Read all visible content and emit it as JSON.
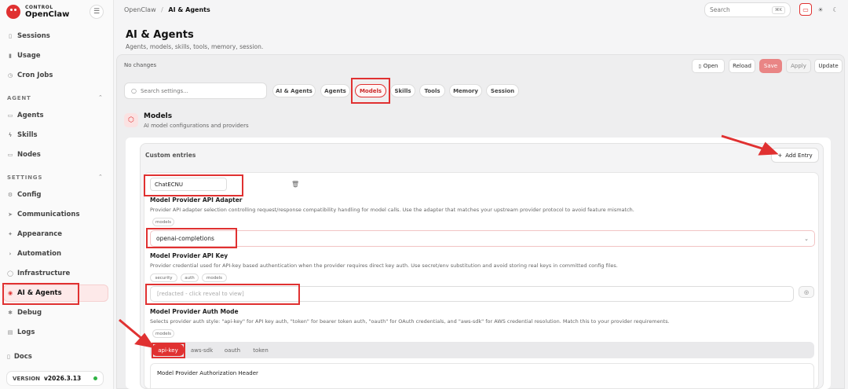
{
  "brand": {
    "label_top": "CONTROL",
    "name": "OpenClaw"
  },
  "sidebar": {
    "top_items": [
      {
        "label": "Sessions",
        "icon": "file-icon"
      },
      {
        "label": "Usage",
        "icon": "bar-chart-icon"
      },
      {
        "label": "Cron Jobs",
        "icon": "clock-icon"
      }
    ],
    "agent_section": "AGENT",
    "agent_items": [
      {
        "label": "Agents",
        "icon": "folder-icon"
      },
      {
        "label": "Skills",
        "icon": "zap-icon"
      },
      {
        "label": "Nodes",
        "icon": "monitor-icon"
      }
    ],
    "settings_section": "SETTINGS",
    "settings_items": [
      {
        "label": "Config",
        "icon": "gear-icon"
      },
      {
        "label": "Communications",
        "icon": "send-icon"
      },
      {
        "label": "Appearance",
        "icon": "sparkle-icon"
      },
      {
        "label": "Automation",
        "icon": "terminal-icon"
      },
      {
        "label": "Infrastructure",
        "icon": "globe-icon"
      },
      {
        "label": "AI & Agents",
        "icon": "robot-icon"
      },
      {
        "label": "Debug",
        "icon": "bug-icon"
      },
      {
        "label": "Logs",
        "icon": "file-text-icon"
      }
    ],
    "docs": "Docs",
    "version_label": "VERSION",
    "version": "v2026.3.13"
  },
  "breadcrumb": {
    "root": "OpenClaw",
    "separator": "/",
    "current": "AI & Agents"
  },
  "top_search": {
    "placeholder": "Search",
    "shortcut": "⌘K"
  },
  "page": {
    "title": "AI & Agents",
    "subtitle": "Agents, models, skills, tools, memory, session."
  },
  "status": "No changes",
  "actions": {
    "open": "Open",
    "reload": "Reload",
    "save": "Save",
    "apply": "Apply",
    "update": "Update"
  },
  "settings_search": {
    "placeholder": "Search settings..."
  },
  "tabs": [
    "AI & Agents",
    "Agents",
    "Models",
    "Skills",
    "Tools",
    "Memory",
    "Session"
  ],
  "active_tab": "Models",
  "section": {
    "title": "Models",
    "subtitle": "AI model configurations and providers"
  },
  "custom_entries": {
    "title": "Custom entries",
    "add_label": "Add Entry"
  },
  "entry": {
    "name_value": "ChatECNU",
    "adapter": {
      "label": "Model Provider API Adapter",
      "description": "Provider API adapter selection controlling request/response compatibility handling for model calls. Use the adapter that matches your upstream provider protocol to avoid feature mismatch.",
      "tags": [
        "models"
      ],
      "value": "openai-completions"
    },
    "api_key": {
      "label": "Model Provider API Key",
      "description": "Provider credential used for API-key based authentication when the provider requires direct key auth. Use secret/env substitution and avoid storing real keys in committed config files.",
      "tags": [
        "security",
        "auth",
        "models"
      ],
      "placeholder": "[redacted - click reveal to view]"
    },
    "auth_mode": {
      "label": "Model Provider Auth Mode",
      "description": "Selects provider auth style: \"api-key\" for API key auth, \"token\" for bearer token auth, \"oauth\" for OAuth credentials, and \"aws-sdk\" for AWS credential resolution. Match this to your provider requirements.",
      "tags": [
        "models"
      ],
      "options": [
        "api-key",
        "aws-sdk",
        "oauth",
        "token"
      ],
      "selected": "api-key"
    },
    "auth_header": {
      "label": "Model Provider Authorization Header"
    }
  },
  "colors": {
    "accent": "#e03131",
    "annotation": "#e03131"
  }
}
